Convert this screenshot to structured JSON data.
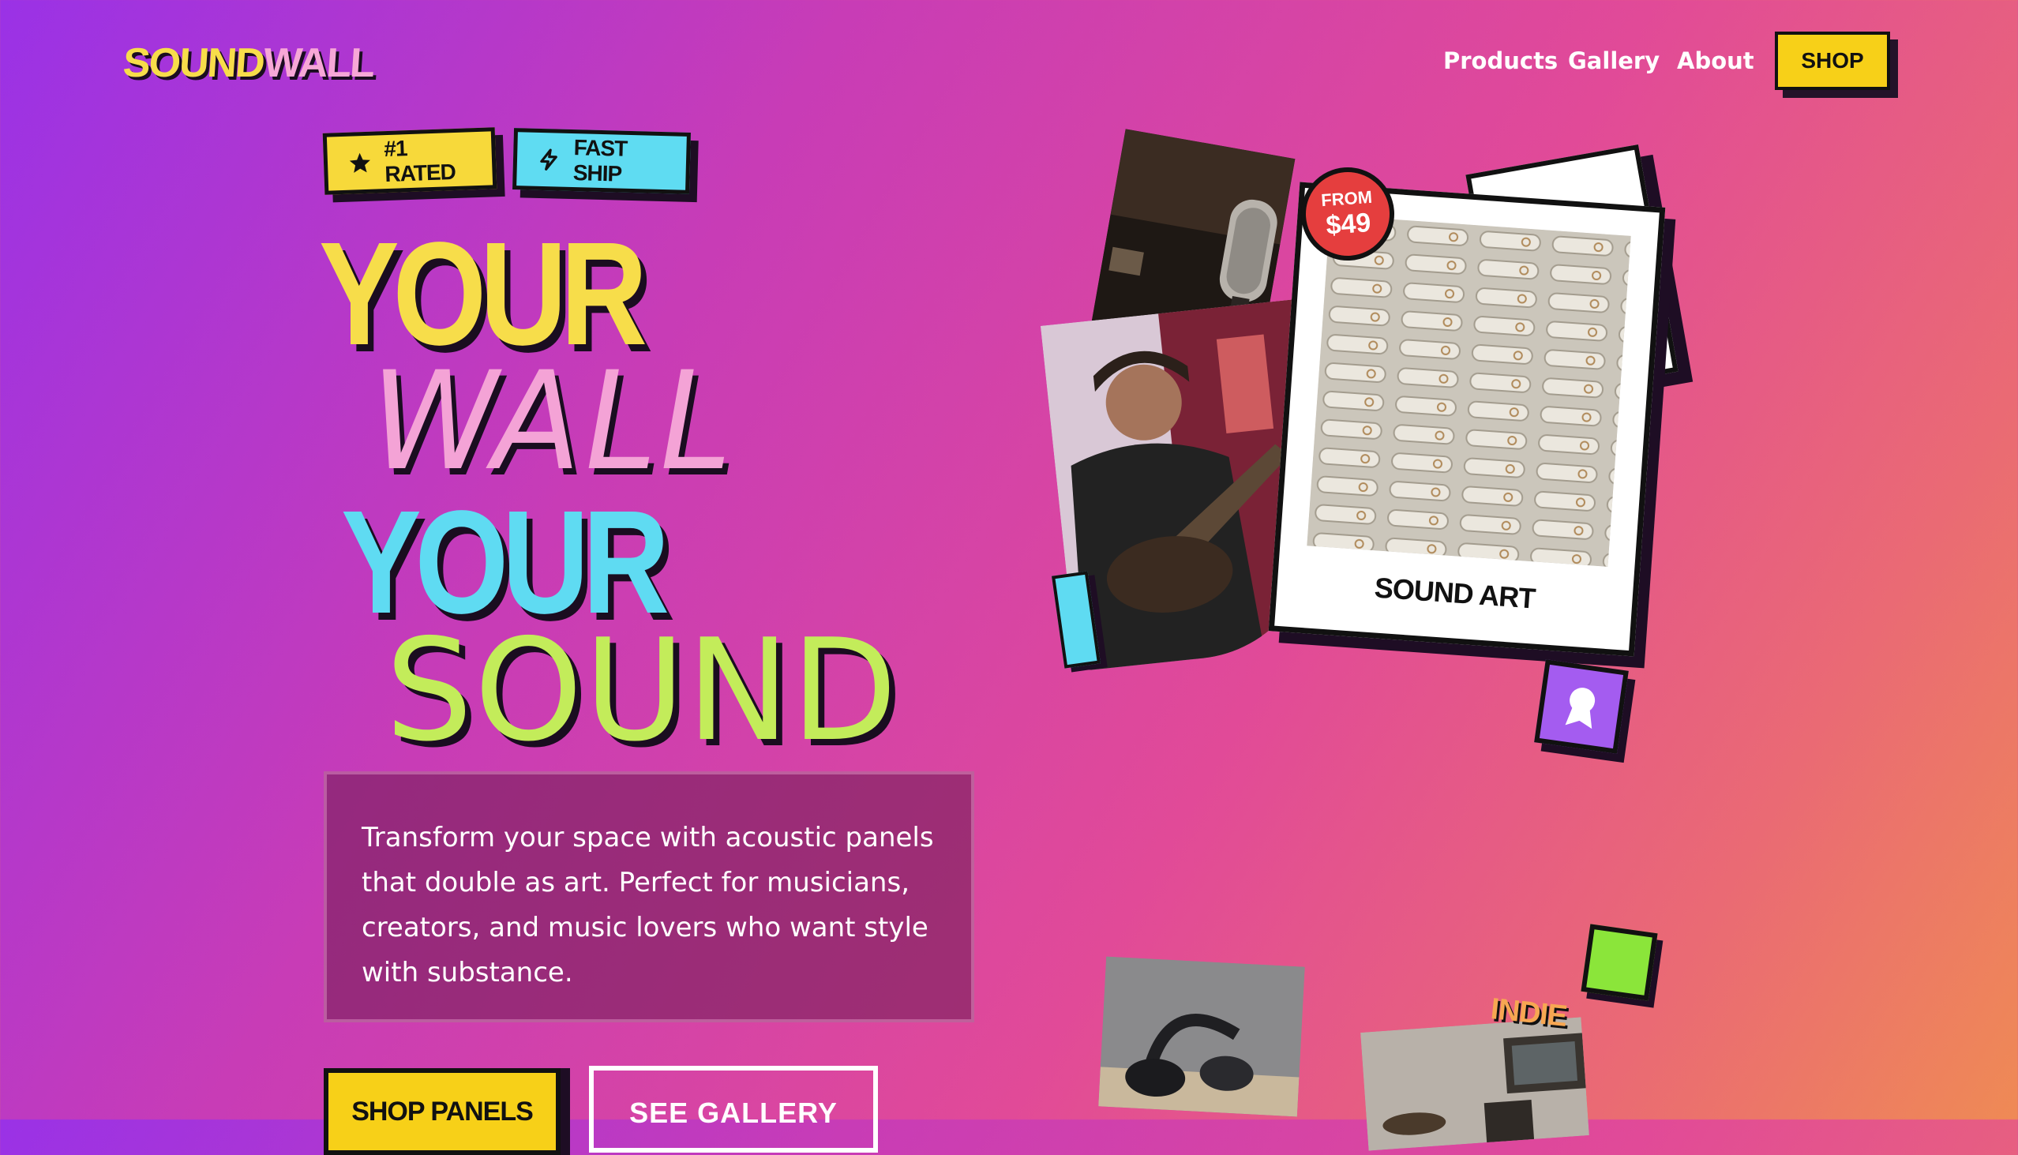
{
  "brand": {
    "part1": "SOUND",
    "part2": "WALL"
  },
  "nav": {
    "links": [
      "Products",
      "Gallery",
      "About"
    ],
    "shop_label": "SHOP"
  },
  "badges": [
    {
      "icon": "star-icon",
      "label": "#1 RATED",
      "color": "#f7d93a"
    },
    {
      "icon": "lightning-icon",
      "label": "FAST SHIP",
      "color": "#5fdcf2"
    }
  ],
  "headline": {
    "line1": "YOUR",
    "line2": "WALL",
    "line3": "YOUR",
    "line4": "SOUND"
  },
  "description": "Transform your space with acoustic panels that double as art. Perfect for musicians, creators, and music lovers who want style with substance.",
  "cta": {
    "primary": "SHOP PANELS",
    "secondary": "SEE GALLERY"
  },
  "collage": {
    "price_sticker": {
      "top": "FROM",
      "price": "$49"
    },
    "polaroid_caption": "SOUND ART",
    "tag_indie": "INDIE",
    "award_icon": "award-ribbon-icon"
  },
  "colors": {
    "yellow": "#f7d018",
    "pink": "#f4a3d6",
    "cyan": "#5fdbf2",
    "lime": "#c3ec5a",
    "purple": "#a45cf0",
    "red": "#e53e3e"
  }
}
